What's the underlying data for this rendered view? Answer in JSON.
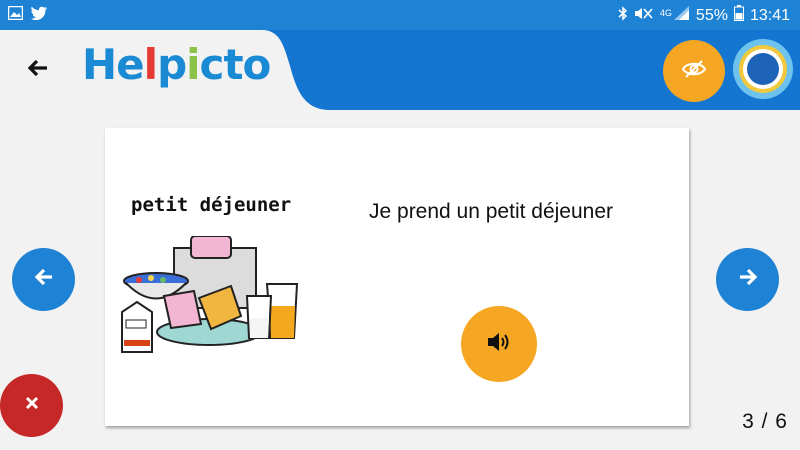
{
  "status_bar": {
    "network": "4G",
    "battery": "55%",
    "time": "13:41"
  },
  "header": {
    "logo_letters": [
      "H",
      "e",
      "l",
      "p",
      "i",
      "c",
      "t",
      "o"
    ],
    "logo_colors": [
      "#1a8ad4",
      "#1a8ad4",
      "#e53935",
      "#1a8ad4",
      "#8bc34a",
      "#1a8ad4",
      "#1a8ad4",
      "#1a8ad4"
    ],
    "accent_color": "#f5a623",
    "bar_color": "#1576d2"
  },
  "card": {
    "picto_label": "petit déjeuner",
    "sentence": "Je prend un petit déjeuner"
  },
  "icons": {
    "back": "arrow-left-icon",
    "visibility": "eye-off-icon",
    "sound": "speaker-icon",
    "prev": "arrow-left-icon",
    "next": "arrow-right-icon",
    "close": "close-icon"
  },
  "pagination": {
    "label": "3 / 6"
  }
}
